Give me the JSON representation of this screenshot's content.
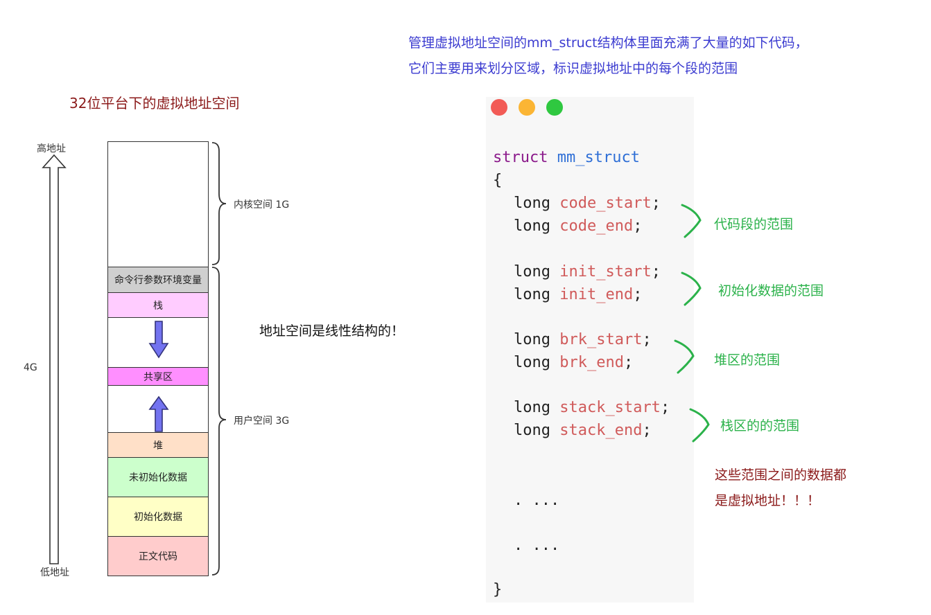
{
  "note_blue": {
    "line1": "管理虚拟地址空间的mm_struct结构体里面充满了大量的如下代码，",
    "line2": "它们主要用来划分区域，标识虚拟地址中的每个段的范围"
  },
  "left_title": "32位平台下的虚拟地址空间",
  "address_labels": {
    "high": "高地址",
    "low": "低地址",
    "size": "4G"
  },
  "segments": [
    {
      "label": "",
      "color": "#ffffff"
    },
    {
      "label": "命令行参数环境变量",
      "color": "#cfcfcf"
    },
    {
      "label": "栈",
      "color": "#ffccff"
    },
    {
      "label": "",
      "color": "#ffffff"
    },
    {
      "label": "共享区",
      "color": "#ff8fff"
    },
    {
      "label": "",
      "color": "#ffffff"
    },
    {
      "label": "堆",
      "color": "#ffe0c8"
    },
    {
      "label": "未初始化数据",
      "color": "#ccffcc"
    },
    {
      "label": "初始化数据",
      "color": "#ffffc6"
    },
    {
      "label": "正文代码",
      "color": "#ffcccc"
    }
  ],
  "brace_labels": {
    "kernel": "内核空间 1G",
    "user": "用户空间 3G"
  },
  "linear_note": "地址空间是线性结构的！",
  "window_dots": [
    "#f25b56",
    "#fbb534",
    "#2fc840"
  ],
  "code": {
    "keyword": "struct",
    "type_name": "mm_struct",
    "open_brace": "{",
    "close_brace": "}",
    "long_kw": "long",
    "fields": [
      "code_start",
      "code_end",
      "init_start",
      "init_end",
      "brk_start",
      "brk_end",
      "stack_start",
      "stack_end"
    ],
    "ellipsis1": ". ...",
    "ellipsis2": ". ..."
  },
  "annotations": [
    "代码段的范围",
    "初始化数据的范围",
    "堆区的范围",
    "栈区的的范围"
  ],
  "red_note": {
    "line1": "这些范围之间的数据都",
    "line2": "是虚拟地址！！！"
  }
}
